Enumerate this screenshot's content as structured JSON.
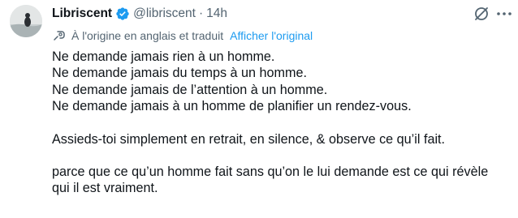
{
  "author": {
    "display_name": "Libriscent",
    "handle": "@libriscent",
    "separator": "·",
    "timestamp": "14h",
    "verified_icon": "verified-badge-icon",
    "verified_color": "#1d9bf0"
  },
  "actions": {
    "grok_icon": "grok-icon",
    "more_icon": "more-options-icon"
  },
  "translation": {
    "icon": "translate-icon",
    "notice": "À l'origine en anglais et traduit",
    "show_original": "Afficher l'original",
    "link_color": "#1d9bf0"
  },
  "tweet": {
    "paragraphs": [
      [
        "Ne demande jamais rien à un homme.",
        "Ne demande jamais du temps à un homme.",
        "Ne demande jamais de l’attention à un homme.",
        "Ne demande jamais à un homme de planifier un rendez-vous."
      ],
      [
        "Assieds-toi simplement en retrait, en silence, & observe ce qu’il fait."
      ],
      [
        "parce que ce qu’un homme fait sans qu’on le lui demande est ce qui révèle",
        "qui il est vraiment."
      ]
    ]
  }
}
